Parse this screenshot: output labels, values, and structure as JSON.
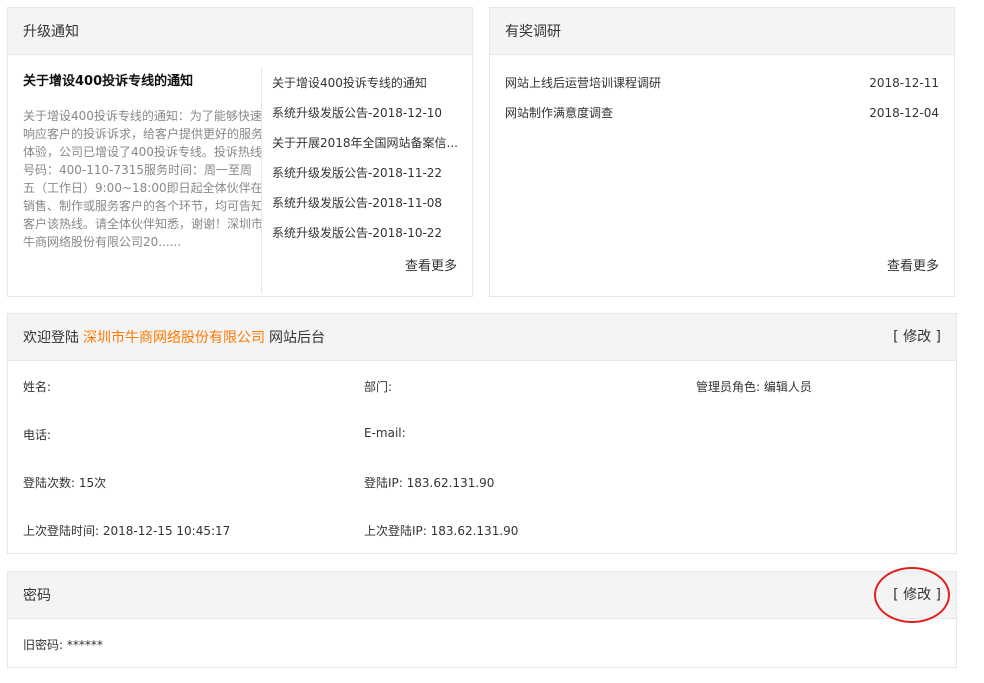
{
  "notice": {
    "title": "升级通知",
    "featured_title": "关于增设400投诉专线的通知",
    "featured_body": "关于增设400投诉专线的通知：为了能够快速响应客户的投诉诉求，给客户提供更好的服务体验，公司已增设了400投诉专线。投诉热线号码：400-110-7315服务时间：周一至周五（工作日）9:00~18:00即日起全体伙伴在销售、制作或服务客户的各个环节，均可告知客户该热线。请全体伙伴知悉，谢谢！深圳市牛商网络股份有限公司20......",
    "items": [
      "关于增设400投诉专线的通知",
      "系统升级发版公告-2018-12-10",
      "关于开展2018年全国网站备案信...",
      "系统升级发版公告-2018-11-22",
      "系统升级发版公告-2018-11-08",
      "系统升级发版公告-2018-10-22"
    ],
    "more": "查看更多"
  },
  "survey": {
    "title": "有奖调研",
    "items": [
      {
        "name": "网站上线后运营培训课程调研",
        "date": "2018-12-11"
      },
      {
        "name": "网站制作满意度调查",
        "date": "2018-12-04"
      }
    ],
    "more": "查看更多"
  },
  "welcome": {
    "prefix": "欢迎登陆",
    "company": "深圳市牛商网络股份有限公司",
    "suffix": "网站后台",
    "edit": "[ 修改 ]",
    "name": "姓名:",
    "dept": "部门:",
    "role": "管理员角色:  编辑人员",
    "phone": "电话:",
    "email": "E-mail:",
    "login_count": "登陆次数: 15次",
    "login_ip": "登陆IP: 183.62.131.90",
    "last_time": "上次登陆时间: 2018-12-15 10:45:17",
    "last_ip": "上次登陆IP: 183.62.131.90"
  },
  "password": {
    "title": "密码",
    "edit": "[ 修改 ]",
    "old": "旧密码:  ******"
  },
  "colors": {
    "accent": "#ff7a00",
    "annotation": "#e0201c"
  }
}
